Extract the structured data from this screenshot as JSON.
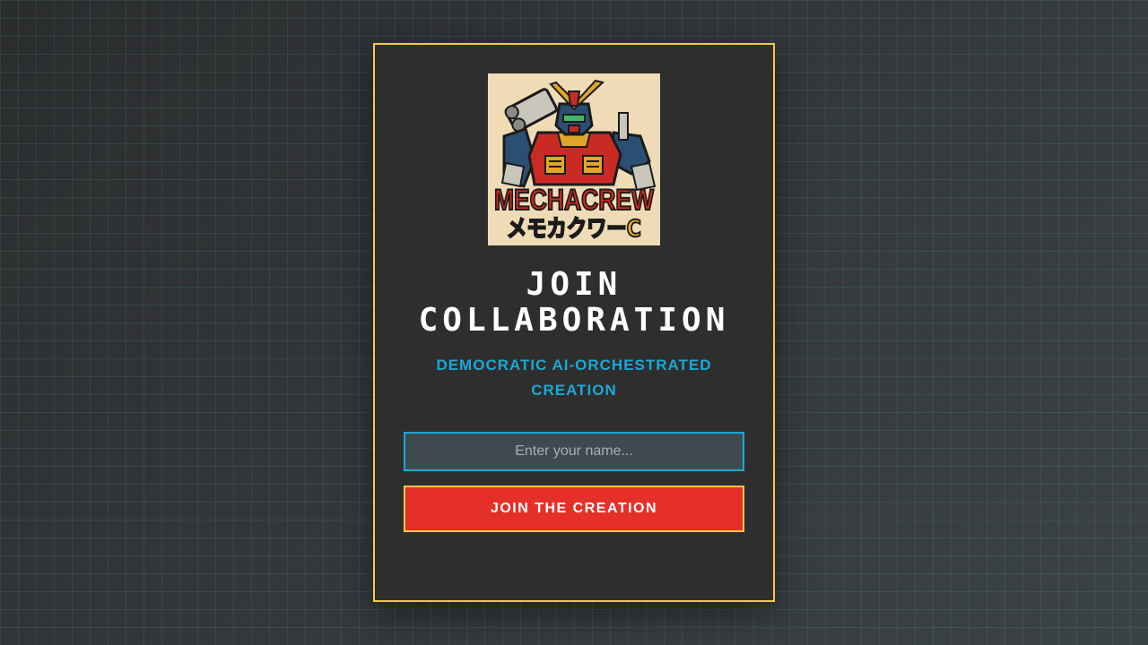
{
  "logo": {
    "text_en": "MECHACREW",
    "text_jp": "メモカクワーC",
    "colors": {
      "background": "#efdcb6",
      "wordmark": "#d4261f",
      "wordmark_jp": "#f2b61c",
      "armor_blue": "#2b4f72",
      "armor_red": "#c92a24"
    }
  },
  "title": {
    "line1": "JOIN",
    "line2": "COLLABORATION"
  },
  "subtitle": {
    "line1": "DEMOCRATIC AI-ORCHESTRATED",
    "line2": "CREATION"
  },
  "form": {
    "name_value": "",
    "name_placeholder": "Enter your name...",
    "join_label": "JOIN THE CREATION"
  },
  "colors": {
    "card_border": "#f2c94c",
    "accent_cyan": "#1ba8d6",
    "button_red": "#e5302a",
    "card_bg": "#2e2e2e"
  }
}
